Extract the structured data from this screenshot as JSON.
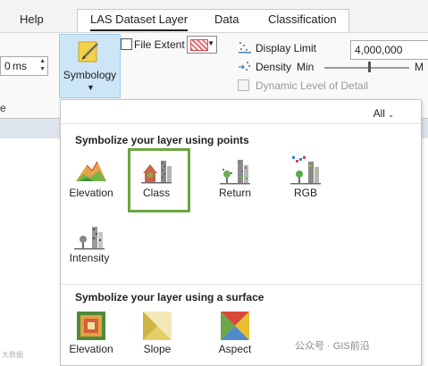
{
  "ribbon": {
    "tabs": [
      {
        "label": "Help"
      },
      {
        "label": "LAS Dataset Layer"
      },
      {
        "label": "Data"
      },
      {
        "label": "Classification"
      }
    ],
    "spin_value": "0",
    "spin_unit": "ms",
    "symbology_label": "Symbology",
    "file_extent_label": "File Extent",
    "display_limit_label": "Display Limit",
    "display_limit_value": "4,000,000",
    "density_label": "Density",
    "density_min": "Min",
    "density_max": "M",
    "dynamic_lod_label": "Dynamic Level of Detail",
    "left_cut_text": "e"
  },
  "gallery": {
    "filter_label": "All",
    "points_header": "Symbolize your layer using points",
    "points_items": [
      {
        "label": "Elevation",
        "icon": "elevation-points-icon"
      },
      {
        "label": "Class",
        "icon": "class-points-icon",
        "selected": true
      },
      {
        "label": "Return",
        "icon": "return-points-icon"
      },
      {
        "label": "RGB",
        "icon": "rgb-points-icon"
      },
      {
        "label": "Intensity",
        "icon": "intensity-points-icon"
      }
    ],
    "surface_header": "Symbolize your layer using a surface",
    "surface_items": [
      {
        "label": "Elevation",
        "icon": "elevation-surface-icon"
      },
      {
        "label": "Slope",
        "icon": "slope-surface-icon"
      },
      {
        "label": "Aspect",
        "icon": "aspect-surface-icon"
      }
    ]
  },
  "colors": {
    "selected_border": "#6ba642",
    "symbology_bg": "#cde6f7"
  },
  "watermark": "公众号 · GIS前沿",
  "watermark_small": "大数据"
}
